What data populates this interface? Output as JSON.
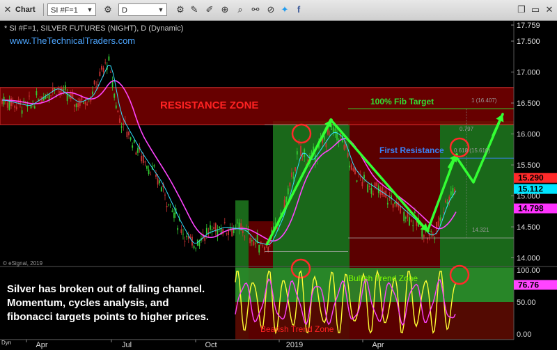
{
  "toolbar": {
    "menu_label": "Chart",
    "symbol_value": "SI #F=1",
    "interval_value": "D",
    "icons": [
      "close-icon",
      "window-icon",
      "cursor-icon",
      "settings-icon",
      "pencil-icon",
      "cursor-pan-icon",
      "drawing-icon",
      "link-icon",
      "tag-icon",
      "zoom-icon",
      "twitter-icon",
      "facebook-icon",
      "restore-icon",
      "minimize-icon",
      "close-window-icon"
    ]
  },
  "chart_header": {
    "title": "* SI #F=1, SILVER FUTURES (NIGHT), D (Dynamic)",
    "website": "www.TheTechnicalTraders.com"
  },
  "chart_data": {
    "type": "candlestick",
    "x_ticks": [
      "Apr",
      "Jul",
      "Oct",
      "2019",
      "Apr"
    ],
    "y_ticks": [
      "17.759",
      "17.500",
      "17.000",
      "16.500",
      "16.000",
      "15.500",
      "15.000",
      "14.500",
      "14.000"
    ],
    "ylim": [
      13.95,
      17.759
    ],
    "price_labels": [
      {
        "value": "15.290",
        "color": "#ff2a2a"
      },
      {
        "value": "15.112",
        "color": "#00e5ff"
      },
      {
        "value": "14.798",
        "color": "#ff33ff"
      }
    ],
    "zones": [
      {
        "label": "RESISTANCE ZONE",
        "color": "#8b0000",
        "y_top": 16.75,
        "y_bottom": 16.15
      }
    ],
    "fibonacci": [
      {
        "label": "1 (16.407)",
        "value": 16.407
      },
      {
        "label": "0.797",
        "value": 15.96
      },
      {
        "label": "0.618 (15.610)",
        "value": 15.61
      },
      {
        "label": "14.321",
        "value": 14.321
      }
    ],
    "annotations": [
      "100% Fib Target",
      "First Resistance"
    ],
    "watermark": "© eSignal, 2019",
    "oscillator": {
      "y_ticks": [
        "100.00",
        "50.00",
        "0.00"
      ],
      "current_value": "76.76",
      "zones": [
        "Bullish Trend Zone",
        "Bearish Trend Zone"
      ],
      "side_label": "Dyn"
    }
  },
  "commentary": "Silver has broken out of falling channel. Momentum, cycles analysis, and fibonacci targets points to higher prices.",
  "colors": {
    "background": "#000000",
    "resistance_zone": "#8b0000",
    "bull_zone": "#1f7a1f",
    "bear_zone": "#6b0000",
    "arrow": "#33ff33",
    "fib_label": "#33dd33",
    "first_resistance": "#3b82f6"
  }
}
